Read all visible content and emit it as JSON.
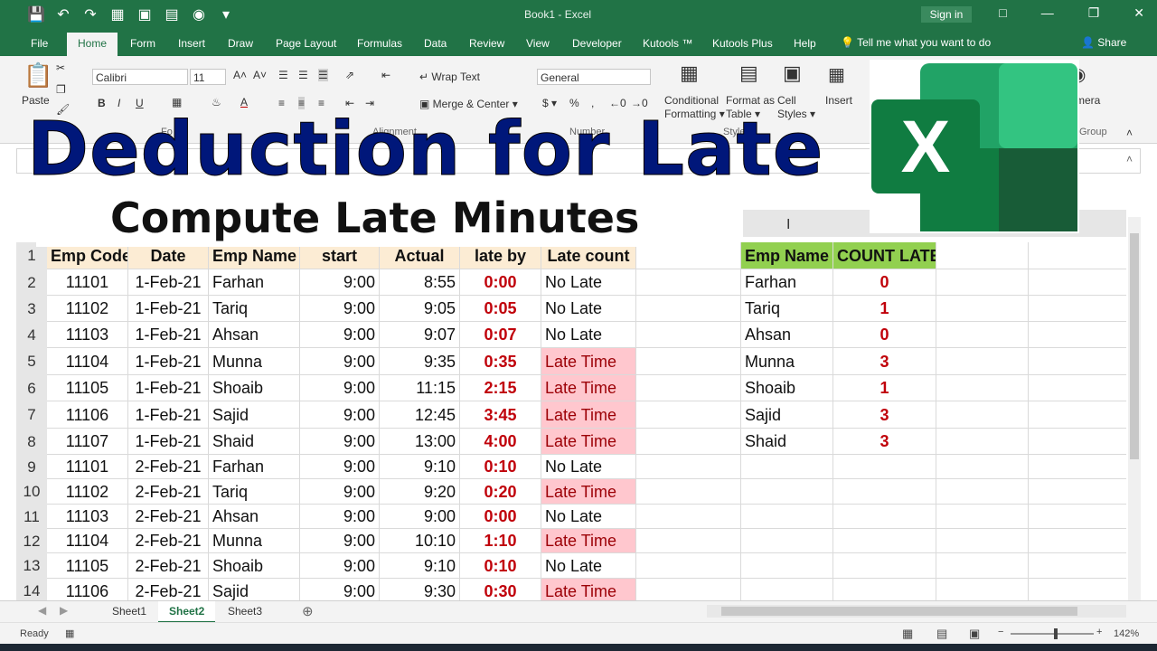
{
  "window": {
    "title": "Book1 - Excel",
    "signin": "Sign in"
  },
  "menu": {
    "tabs": [
      "File",
      "Home",
      "Form",
      "Insert",
      "Draw",
      "Page Layout",
      "Formulas",
      "Data",
      "Review",
      "View",
      "Developer",
      "Kutools ™",
      "Kutools Plus",
      "Help"
    ],
    "tellme": "Tell me what you want to do",
    "share": "Share"
  },
  "ribbon": {
    "paste": "Paste",
    "font_name": "Calibri",
    "font_size": "11",
    "wrap_text": "Wrap Text",
    "merge_center": "Merge & Center",
    "number_format": "General",
    "conditional_formatting": [
      "Conditional",
      "Formatting"
    ],
    "format_as_table": [
      "Format as",
      "Table"
    ],
    "cell_styles": [
      "Cell",
      "Styles"
    ],
    "insert": "Insert",
    "camera": "mera",
    "groups": {
      "alignment": "Alignment",
      "number": "Number",
      "styles": "Styles",
      "group": "Group"
    }
  },
  "overlay": {
    "title": "Deduction for Late",
    "subtitle": "Compute Late Minutes"
  },
  "column_header_visible": "I",
  "headers": [
    "Emp Code",
    "Date",
    "Emp Name",
    "start",
    "Actual",
    "late by",
    "Late count"
  ],
  "rows": [
    {
      "n": "2",
      "code": "11101",
      "date": "1-Feb-21",
      "name": "Farhan",
      "start": "9:00",
      "actual": "8:55",
      "late": "0:00",
      "count": "No Late",
      "is_late": false
    },
    {
      "n": "3",
      "code": "11102",
      "date": "1-Feb-21",
      "name": "Tariq",
      "start": "9:00",
      "actual": "9:05",
      "late": "0:05",
      "count": "No Late",
      "is_late": false
    },
    {
      "n": "4",
      "code": "11103",
      "date": "1-Feb-21",
      "name": "Ahsan",
      "start": "9:00",
      "actual": "9:07",
      "late": "0:07",
      "count": "No Late",
      "is_late": false
    },
    {
      "n": "5",
      "code": "11104",
      "date": "1-Feb-21",
      "name": "Munna",
      "start": "9:00",
      "actual": "9:35",
      "late": "0:35",
      "count": "Late Time",
      "is_late": true
    },
    {
      "n": "6",
      "code": "11105",
      "date": "1-Feb-21",
      "name": "Shoaib",
      "start": "9:00",
      "actual": "11:15",
      "late": "2:15",
      "count": "Late Time",
      "is_late": true
    },
    {
      "n": "7",
      "code": "11106",
      "date": "1-Feb-21",
      "name": "Sajid",
      "start": "9:00",
      "actual": "12:45",
      "late": "3:45",
      "count": "Late Time",
      "is_late": true
    },
    {
      "n": "8",
      "code": "11107",
      "date": "1-Feb-21",
      "name": "Shaid",
      "start": "9:00",
      "actual": "13:00",
      "late": "4:00",
      "count": "Late Time",
      "is_late": true
    },
    {
      "n": "9",
      "code": "11101",
      "date": "2-Feb-21",
      "name": "Farhan",
      "start": "9:00",
      "actual": "9:10",
      "late": "0:10",
      "count": "No Late",
      "is_late": false
    },
    {
      "n": "10",
      "code": "11102",
      "date": "2-Feb-21",
      "name": "Tariq",
      "start": "9:00",
      "actual": "9:20",
      "late": "0:20",
      "count": "Late Time",
      "is_late": true
    },
    {
      "n": "11",
      "code": "11103",
      "date": "2-Feb-21",
      "name": "Ahsan",
      "start": "9:00",
      "actual": "9:00",
      "late": "0:00",
      "count": "No Late",
      "is_late": false
    },
    {
      "n": "12",
      "code": "11104",
      "date": "2-Feb-21",
      "name": "Munna",
      "start": "9:00",
      "actual": "10:10",
      "late": "1:10",
      "count": "Late Time",
      "is_late": true
    },
    {
      "n": "13",
      "code": "11105",
      "date": "2-Feb-21",
      "name": "Shoaib",
      "start": "9:00",
      "actual": "9:10",
      "late": "0:10",
      "count": "No Late",
      "is_late": false
    },
    {
      "n": "14",
      "code": "11106",
      "date": "2-Feb-21",
      "name": "Sajid",
      "start": "9:00",
      "actual": "9:30",
      "late": "0:30",
      "count": "Late Time",
      "is_late": true
    }
  ],
  "summary_headers": [
    "Emp Name",
    "COUNT LATE"
  ],
  "summary": [
    {
      "name": "Farhan",
      "count": "0"
    },
    {
      "name": "Tariq",
      "count": "1"
    },
    {
      "name": "Ahsan",
      "count": "0"
    },
    {
      "name": "Munna",
      "count": "3"
    },
    {
      "name": "Shoaib",
      "count": "1"
    },
    {
      "name": "Sajid",
      "count": "3"
    },
    {
      "name": "Shaid",
      "count": "3"
    }
  ],
  "sheets": [
    "Sheet1",
    "Sheet2",
    "Sheet3"
  ],
  "active_sheet": "Sheet2",
  "status": {
    "ready": "Ready",
    "zoom": "142%"
  },
  "colors": {
    "excel_green": "#217346",
    "late_pink": "#ffc7ce",
    "late_red": "#c0000a",
    "header_peach": "#fcecd4",
    "summary_green": "#92d050",
    "title_blue": "#00177a"
  }
}
